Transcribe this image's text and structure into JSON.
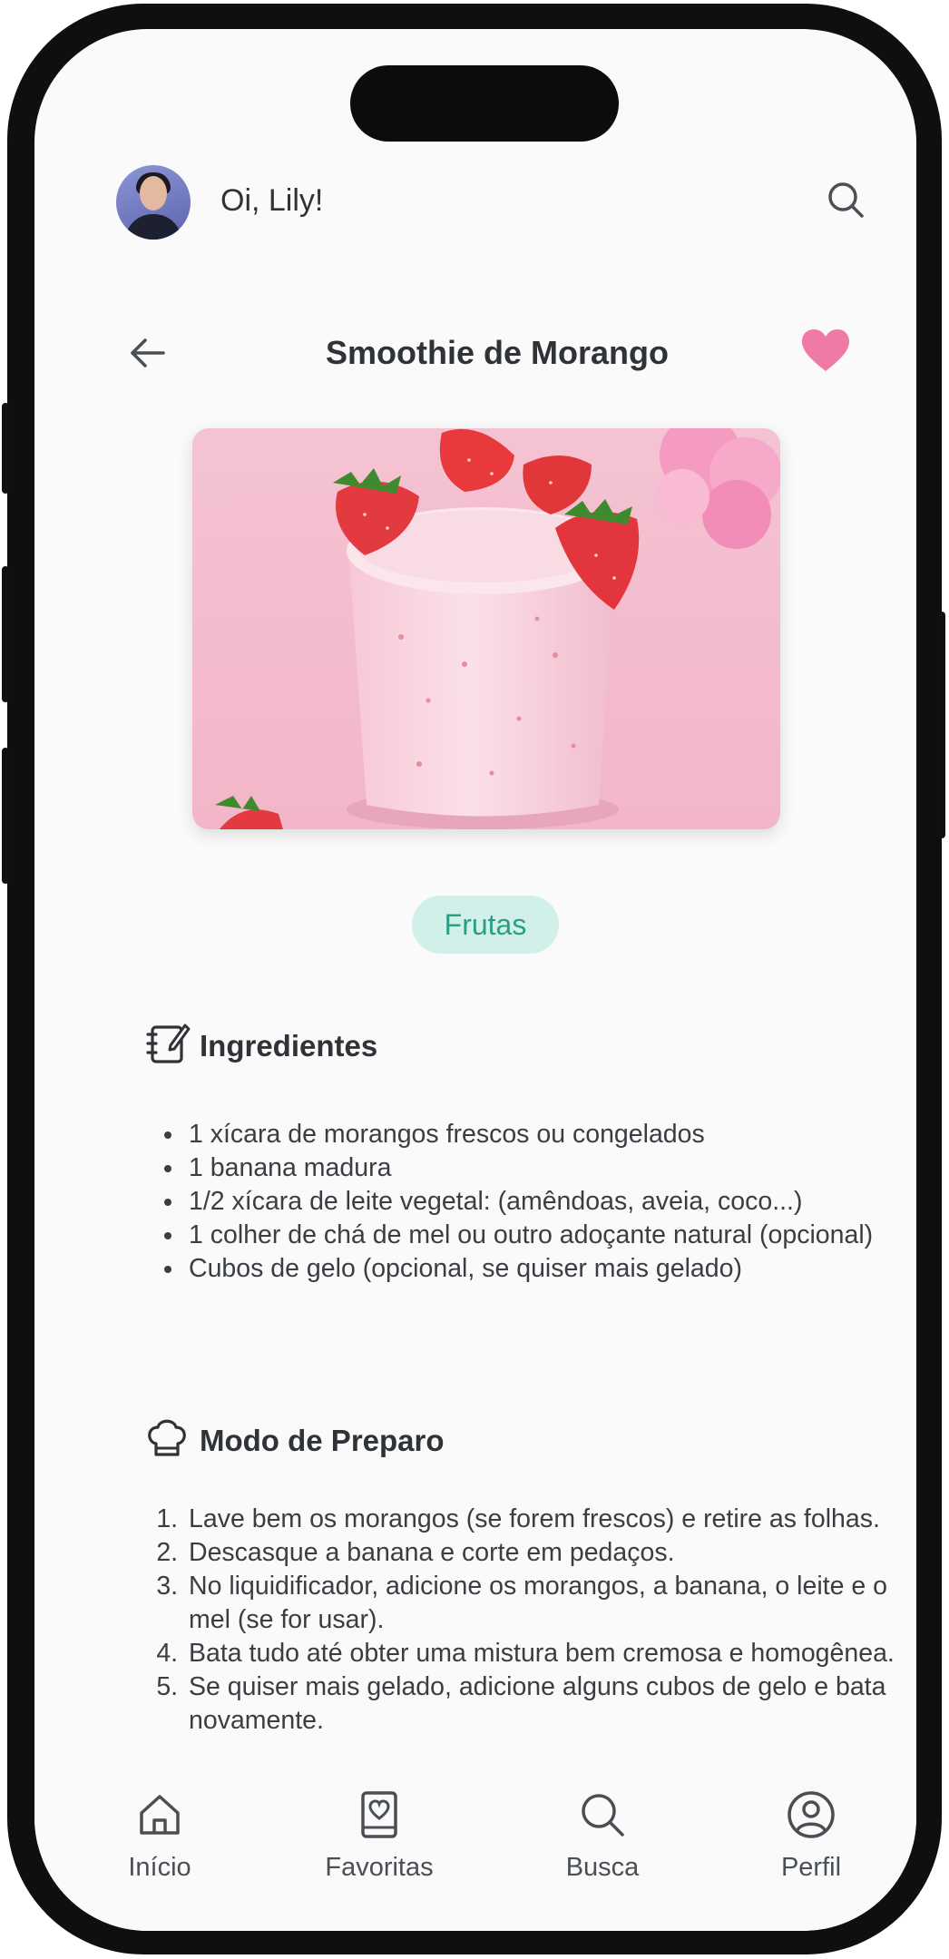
{
  "header": {
    "greeting": "Oi, Lily!",
    "avatar_icon": "user-avatar",
    "search_icon": "search-icon"
  },
  "recipe": {
    "title": "Smoothie de Morango",
    "favorited": true,
    "favorite_color": "#f07aa6",
    "image_subject": "strawberry smoothie in glass",
    "category": "Frutas"
  },
  "ingredients": {
    "heading": "Ingredientes",
    "items": [
      "1 xícara de morangos frescos ou congelados",
      "1 banana madura",
      "1/2 xícara de leite vegetal: (amêndoas, aveia, coco...)",
      "1 colher de chá de mel ou outro adoçante natural (opcional)",
      "Cubos de gelo (opcional, se quiser mais gelado)"
    ]
  },
  "preparation": {
    "heading": "Modo de Preparo",
    "steps": [
      "Lave bem os morangos (se forem frescos) e retire as folhas.",
      "Descasque a banana e corte em pedaços.",
      "No liquidificador, adicione os morangos, a banana, o leite e o mel (se for usar).",
      "Bata tudo até obter uma mistura bem cremosa e homogênea.",
      "Se quiser mais gelado, adicione alguns cubos de gelo e bata novamente."
    ]
  },
  "nav": {
    "items": [
      {
        "label": "Início",
        "icon": "home-icon"
      },
      {
        "label": "Favoritas",
        "icon": "recipe-book-icon"
      },
      {
        "label": "Busca",
        "icon": "search-icon"
      },
      {
        "label": "Perfil",
        "icon": "profile-icon"
      }
    ]
  },
  "colors": {
    "accent_green": "#2a9f86",
    "tag_bg": "#d2f0ea",
    "heart": "#f07aa6"
  }
}
